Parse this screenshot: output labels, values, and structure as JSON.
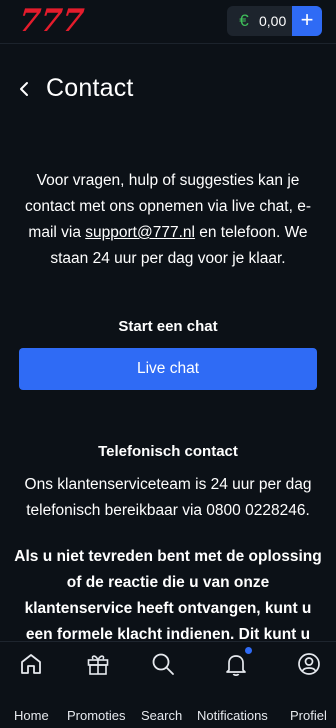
{
  "header": {
    "logo_text": "777",
    "currency_symbol": "€",
    "balance": "0,00",
    "deposit_button": "+"
  },
  "page": {
    "title": "Contact"
  },
  "content": {
    "intro_before_link": "Voor vragen, hulp of suggesties kan je contact met ons opnemen via live chat, e-mail via ",
    "support_email": "support@777.nl",
    "intro_after_link": " en telefoon. We staan 24 uur per dag voor je klaar.",
    "chat_heading": "Start een chat",
    "live_chat_button": "Live chat",
    "phone_heading": "Telefonisch contact",
    "phone_text": "Ons klantenserviceteam is 24 uur per dag telefonisch bereikbaar via 0800 0228246.",
    "complaint_text": "Als u niet tevreden bent met de oplossing of de reactie die u van onze klantenservice heeft ontvangen, kunt u een formele klacht indienen. Dit kunt u doen door een e-mail te sturen naar"
  },
  "bottom_nav": {
    "items": [
      {
        "label": "Home",
        "icon": "home-icon"
      },
      {
        "label": "Promoties",
        "icon": "gift-icon"
      },
      {
        "label": "Search",
        "icon": "search-icon"
      },
      {
        "label": "Notifications",
        "icon": "bell-icon"
      },
      {
        "label": "Profiel",
        "icon": "profile-icon"
      }
    ]
  },
  "colors": {
    "background": "#0c1117",
    "accent": "#2f6bf5",
    "logo": "#e51c2c",
    "euro": "#3fbf5a"
  }
}
